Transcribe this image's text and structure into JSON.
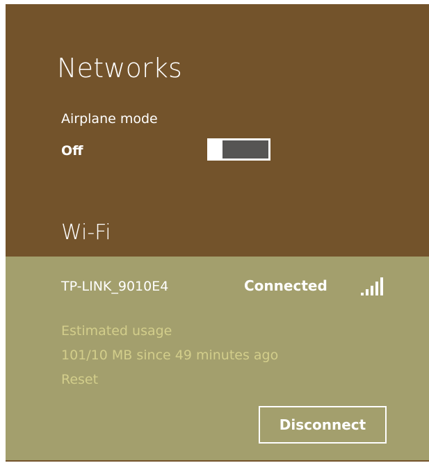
{
  "panel": {
    "title": "Networks"
  },
  "airplane_mode": {
    "label": "Airplane mode",
    "state": "Off",
    "enabled": false
  },
  "wifi": {
    "heading": "Wi-Fi",
    "network": {
      "ssid": "TP-LINK_9010E4",
      "status": "Connected",
      "signal_bars": 5,
      "signal_icon": "signal-strength-icon",
      "usage": {
        "label": "Estimated usage",
        "detail": "101/10 MB since 49 minutes ago",
        "reset_label": "Reset"
      },
      "disconnect_label": "Disconnect"
    }
  },
  "colors": {
    "panel_background": "#73532b",
    "network_background": "#a39f6d",
    "usage_text": "#d3ce8b",
    "toggle_track": "#565554",
    "text": "#ffffff"
  }
}
